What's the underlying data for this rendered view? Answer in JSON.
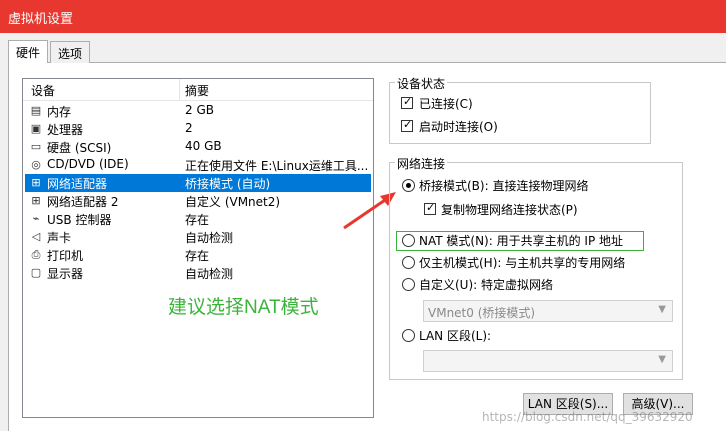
{
  "window": {
    "title": "虚拟机设置"
  },
  "tabs": [
    {
      "label": "硬件"
    },
    {
      "label": "选项"
    }
  ],
  "device_list": {
    "headers": {
      "device": "设备",
      "summary": "摘要"
    },
    "rows": [
      {
        "icon": "memory-icon",
        "device": "内存",
        "summary": "2 GB"
      },
      {
        "icon": "processor-icon",
        "device": "处理器",
        "summary": "2"
      },
      {
        "icon": "hard-disk-icon",
        "device": "硬盘 (SCSI)",
        "summary": "40 GB"
      },
      {
        "icon": "cd-dvd-icon",
        "device": "CD/DVD (IDE)",
        "summary": "正在使用文件 E:\\Linux运维工具..."
      },
      {
        "icon": "network-adapter-icon",
        "device": "网络适配器",
        "summary": "桥接模式 (自动)"
      },
      {
        "icon": "network-adapter-icon",
        "device": "网络适配器 2",
        "summary": "自定义 (VMnet2)"
      },
      {
        "icon": "usb-icon",
        "device": "USB 控制器",
        "summary": "存在"
      },
      {
        "icon": "sound-icon",
        "device": "声卡",
        "summary": "自动检测"
      },
      {
        "icon": "printer-icon",
        "device": "打印机",
        "summary": "存在"
      },
      {
        "icon": "display-icon",
        "device": "显示器",
        "summary": "自动检测"
      }
    ],
    "selected_index": 4
  },
  "annotation": {
    "text": "建议选择NAT模式",
    "color": "#3cb43c"
  },
  "device_status": {
    "label": "设备状态",
    "connected": "已连接(C)",
    "connect_at_power_on": "启动时连接(O)"
  },
  "network_connection": {
    "label": "网络连接",
    "bridged": "桥接模式(B): 直接连接物理网络",
    "replicate": "复制物理网络连接状态(P)",
    "nat": "NAT 模式(N): 用于共享主机的 IP 地址",
    "host_only": "仅主机模式(H): 与主机共享的专用网络",
    "custom": "自定义(U): 特定虚拟网络",
    "custom_value": "VMnet0 (桥接模式)",
    "lan": "LAN 区段(L):",
    "lan_value": ""
  },
  "buttons": {
    "lan_segments": "LAN 区段(S)...",
    "advanced": "高级(V)..."
  },
  "watermark": "https://blog.csdn.net/qq_39632920",
  "colors": {
    "title_bar": "#e8372f",
    "selection": "#0078d7",
    "arrow": "#e8372f",
    "highlight_box": "#3cb43c"
  }
}
